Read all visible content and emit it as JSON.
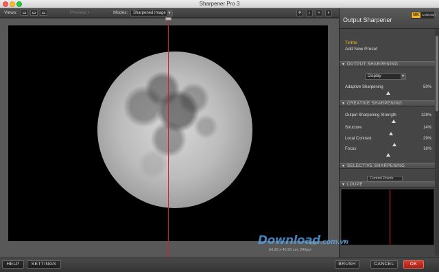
{
  "window": {
    "title": "Sharpener Pro 3"
  },
  "toolbar": {
    "views_label": "Views:",
    "preview_label": "Preview:",
    "modes_label": "Modes:",
    "mode_value": "Sharpened Image",
    "view_buttons": [
      "single-view-icon",
      "split-view-icon",
      "side-by-side-view-icon"
    ],
    "tool_buttons": [
      "hand-icon",
      "zoom-icon",
      "crop-icon",
      "info-icon"
    ]
  },
  "canvas": {
    "info_label": "Info",
    "dims_label": "64.26 x 42.66 cm, 240ppi"
  },
  "panel": {
    "title": "Output Sharpener",
    "logo_box": "NIK",
    "logo_text": "Collection",
    "presets": {
      "active": "Tinhte",
      "add": "Add New Preset"
    },
    "sections": {
      "output": "OUTPUT SHARPENING",
      "creative": "CREATIVE SHARPENING",
      "selective": "SELECTIVE SHARPENING",
      "loupe": "LOUPE"
    },
    "display_select": "Display",
    "control_points": "Control Points",
    "sliders": [
      {
        "name": "Adaptive Sharpening",
        "value": "50%",
        "level": 0.5
      },
      {
        "name": "Output Sharpening Strength",
        "value": "128%",
        "level": 0.56
      },
      {
        "name": "Structure",
        "value": "14%",
        "level": 0.53
      },
      {
        "name": "Local Contrast",
        "value": "29%",
        "level": 0.57
      },
      {
        "name": "Focus",
        "value": "16%",
        "level": 0.5
      }
    ]
  },
  "bottom": {
    "help": "HELP",
    "settings": "SETTINGS",
    "brush": "BRUSH",
    "cancel": "CANCEL",
    "ok": "OK"
  },
  "watermark": {
    "main": "Download",
    "tld": ".com.vn"
  },
  "colors": {
    "accent": "#f1b625",
    "divider": "#e01b1b",
    "ok": "#c7301f"
  }
}
